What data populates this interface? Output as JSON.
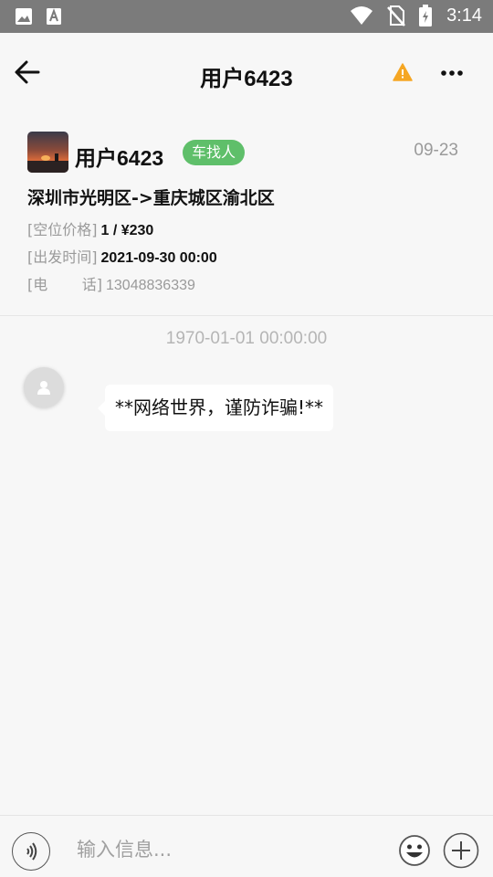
{
  "status_bar": {
    "time": "3:14",
    "left_icons": [
      "image-icon",
      "font-a-icon"
    ],
    "right_icons": [
      "wifi-icon",
      "no-sim-icon",
      "battery-icon"
    ]
  },
  "header": {
    "title": "用户6423",
    "actions": [
      "warning-icon",
      "more-icon"
    ],
    "warning_color": "#f5a623"
  },
  "post": {
    "poster_name": "用户6423",
    "role_badge": "车找人",
    "badge_color": "#5fbf6a",
    "date": "09-23",
    "route": "深圳市光明区->重庆城区渝北区",
    "price_label": "[空位价格]",
    "price_value": "1 / ¥230",
    "depart_label": "[出发时间]",
    "depart_value": "2021-09-30 00:00",
    "phone_label_left": "[电",
    "phone_label_right": "话]",
    "phone_value": "13048836339"
  },
  "chat": {
    "timestamp": "1970-01-01 00:00:00",
    "message": "**网络世界，谨防诈骗!**"
  },
  "input_bar": {
    "placeholder": "输入信息..."
  }
}
